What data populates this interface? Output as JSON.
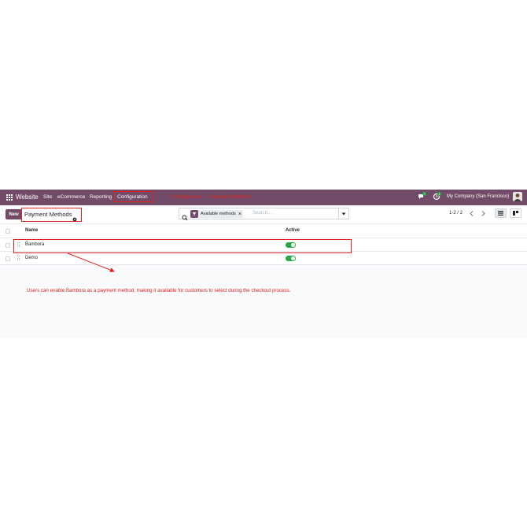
{
  "navbar": {
    "brand": "Website",
    "menu": [
      "Site",
      "eCommerce",
      "Reporting",
      "Configuration"
    ],
    "annotation": "Configuration → Payment Methods",
    "chat_badge": "7",
    "activity_badge": "4",
    "company": "My Company (San Francisco)"
  },
  "controls": {
    "new_label": "New",
    "page_title": "Payment Methods",
    "search": {
      "facet_label": "Available methods",
      "facet_close": "×",
      "placeholder": "Search..."
    },
    "pager": "1-2 / 2"
  },
  "list": {
    "columns": {
      "name": "Name",
      "active": "Active"
    },
    "rows": [
      {
        "name": "Bambora",
        "active": true
      },
      {
        "name": "Demo",
        "active": true
      }
    ]
  },
  "annotation_body": "Users can enable Bambora as a payment method, making it available for customers to select during the checkout process.",
  "colors": {
    "brand": "#714b67",
    "annotation": "#e02020",
    "toggle_on": "#28a745"
  }
}
